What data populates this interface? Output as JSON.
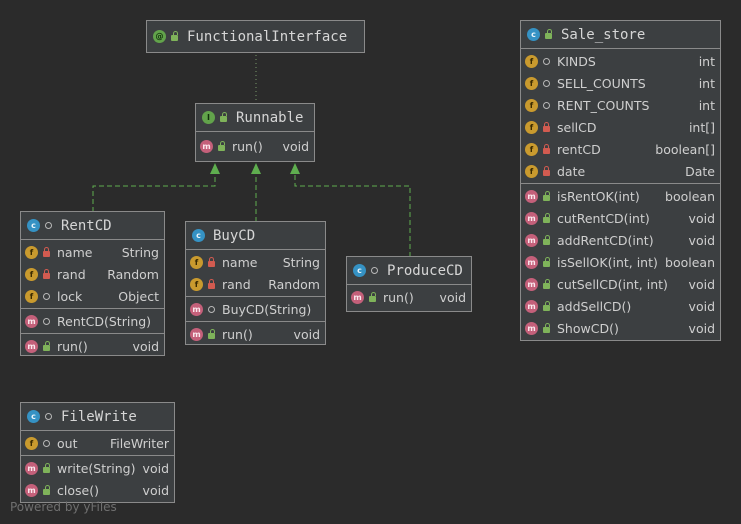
{
  "diagram": {
    "functional_interface": {
      "title": "FunctionalInterface"
    },
    "runnable": {
      "title": "Runnable",
      "method": {
        "name": "run()",
        "type": "void"
      }
    },
    "rentcd": {
      "title": "RentCD",
      "fields": [
        {
          "name": "name",
          "type": "String"
        },
        {
          "name": "rand",
          "type": "Random"
        },
        {
          "name": "lock",
          "type": "Object"
        }
      ],
      "constructor": {
        "name": "RentCD(String)"
      },
      "method": {
        "name": "run()",
        "type": "void"
      }
    },
    "buycd": {
      "title": "BuyCD",
      "fields": [
        {
          "name": "name",
          "type": "String"
        },
        {
          "name": "rand",
          "type": "Random"
        }
      ],
      "constructor": {
        "name": "BuyCD(String)"
      },
      "method": {
        "name": "run()",
        "type": "void"
      }
    },
    "producecd": {
      "title": "ProduceCD",
      "method": {
        "name": "run()",
        "type": "void"
      }
    },
    "filewrite": {
      "title": "FileWrite",
      "field": {
        "name": "out",
        "type": "FileWriter"
      },
      "methods": [
        {
          "name": "write(String)",
          "type": "void"
        },
        {
          "name": "close()",
          "type": "void"
        }
      ]
    },
    "sale_store": {
      "title": "Sale_store",
      "fields": [
        {
          "name": "KINDS",
          "type": "int"
        },
        {
          "name": "SELL_COUNTS",
          "type": "int"
        },
        {
          "name": "RENT_COUNTS",
          "type": "int"
        },
        {
          "name": "sellCD",
          "type": "int[]"
        },
        {
          "name": "rentCD",
          "type": "boolean[]"
        },
        {
          "name": "date",
          "type": "Date"
        }
      ],
      "methods": [
        {
          "name": "isRentOK(int)",
          "type": "boolean"
        },
        {
          "name": "cutRentCD(int)",
          "type": "void"
        },
        {
          "name": "addRentCD(int)",
          "type": "void"
        },
        {
          "name": "isSellOK(int, int)",
          "type": "boolean"
        },
        {
          "name": "cutSellCD(int, int)",
          "type": "void"
        },
        {
          "name": "addSellCD()",
          "type": "void"
        },
        {
          "name": "ShowCD()",
          "type": "void"
        }
      ]
    },
    "icons": {
      "class": "class-icon",
      "interface": "interface-icon",
      "annotation": "annotation-icon",
      "field": "field-icon",
      "method": "method-icon",
      "private": "lock-icon",
      "public": "unlock-icon",
      "package": "package-icon"
    },
    "colors": {
      "background": "#2b2b2b",
      "node": "#3c3f41",
      "class_badge": "#3592c4",
      "field_badge": "#c99a2e",
      "method_badge": "#c4607a",
      "interface_badge": "#62a34b",
      "implements_edge": "#5fae4f"
    }
  },
  "footer": "Powered by yFiles"
}
